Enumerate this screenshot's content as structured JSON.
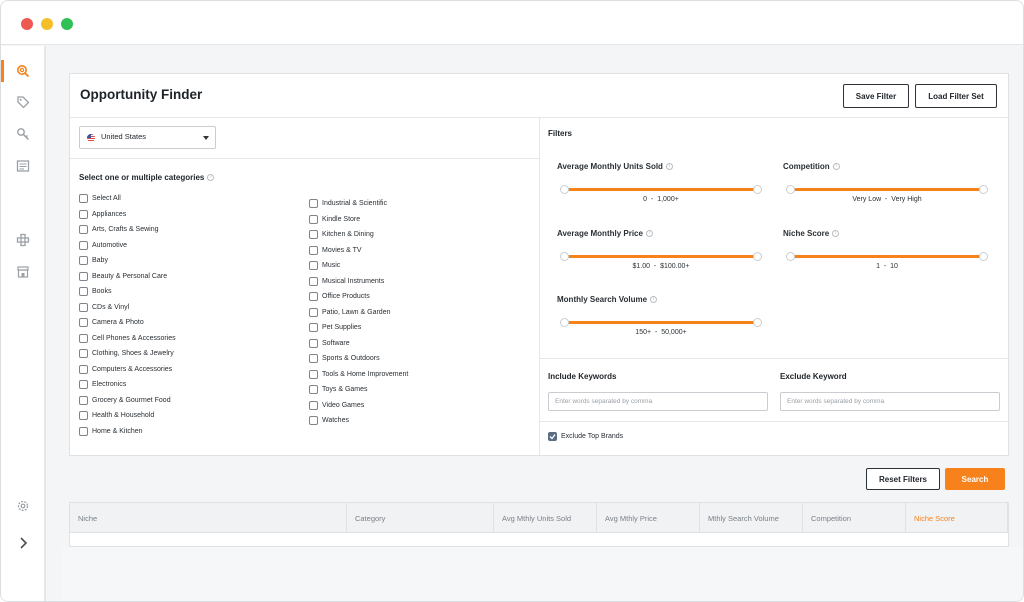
{
  "page": {
    "title": "Opportunity Finder"
  },
  "header": {
    "save_filter": "Save Filter",
    "load_filter_set": "Load Filter Set"
  },
  "country": {
    "selected": "United States"
  },
  "categories": {
    "heading": "Select one or multiple categories",
    "col1": [
      "Select All",
      "Appliances",
      "Arts, Crafts & Sewing",
      "Automotive",
      "Baby",
      "Beauty & Personal Care",
      "Books",
      "CDs & Vinyl",
      "Camera & Photo",
      "Cell Phones & Accessories",
      "Clothing, Shoes & Jewelry",
      "Computers & Accessories",
      "Electronics",
      "Grocery & Gourmet Food",
      "Health & Household",
      "Home & Kitchen"
    ],
    "col2": [
      "Industrial & Scientific",
      "Kindle Store",
      "Kitchen & Dining",
      "Movies & TV",
      "Music",
      "Musical Instruments",
      "Office Products",
      "Patio, Lawn & Garden",
      "Pet Supplies",
      "Software",
      "Sports & Outdoors",
      "Tools & Home Improvement",
      "Toys & Games",
      "Video Games",
      "Watches"
    ]
  },
  "filters": {
    "label": "Filters",
    "units_sold": {
      "name": "Average Monthly Units Sold",
      "min": "0",
      "max": "1,000+"
    },
    "competition": {
      "name": "Competition",
      "min": "Very Low",
      "max": "Very High"
    },
    "price": {
      "name": "Average Monthly Price",
      "min": "$1.00",
      "max": "$100.00+"
    },
    "niche_score": {
      "name": "Niche Score",
      "min": "1",
      "max": "10"
    },
    "search_volume": {
      "name": "Monthly Search Volume",
      "min": "150+",
      "max": "50,000+"
    },
    "separator": "-"
  },
  "keywords": {
    "include_label": "Include Keywords",
    "include_placeholder": "Enter words separated by comma",
    "exclude_label": "Exclude Keyword",
    "exclude_placeholder": "Enter words separated by comma"
  },
  "exclude_top_brands": {
    "label": "Exclude Top Brands",
    "checked": true
  },
  "actions": {
    "reset": "Reset Filters",
    "search": "Search"
  },
  "table": {
    "columns": [
      "Niche",
      "Category",
      "Avg Mthly Units Sold",
      "Avg Mthly Price",
      "Mthly Search Volume",
      "Competition",
      "Niche Score"
    ],
    "sorted_column": "Niche Score"
  },
  "colors": {
    "accent": "#f7821b",
    "checkbox_checked": "#5a6d80"
  },
  "icons": [
    "search-icon",
    "tag-icon",
    "key-icon",
    "book-icon",
    "crosshair-icon",
    "store-icon",
    "settings-icon",
    "chevron-right-icon"
  ]
}
